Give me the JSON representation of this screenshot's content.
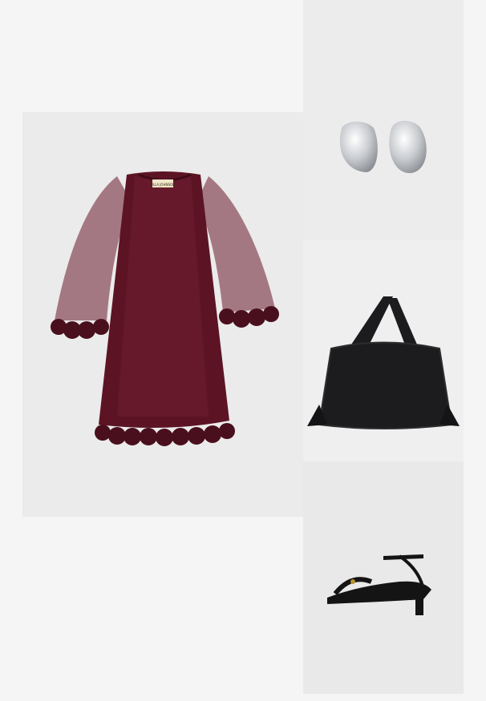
{
  "products": [
    {
      "id": "dress",
      "kind": "dress",
      "color": "#5c1424",
      "label_text": "ULLA JOHNSON"
    },
    {
      "id": "earrings",
      "kind": "earrings",
      "color": "#c9ccd0"
    },
    {
      "id": "bag",
      "kind": "tote-bag",
      "color": "#1c1c1e"
    },
    {
      "id": "sandal",
      "kind": "sandal",
      "color": "#141414"
    }
  ]
}
